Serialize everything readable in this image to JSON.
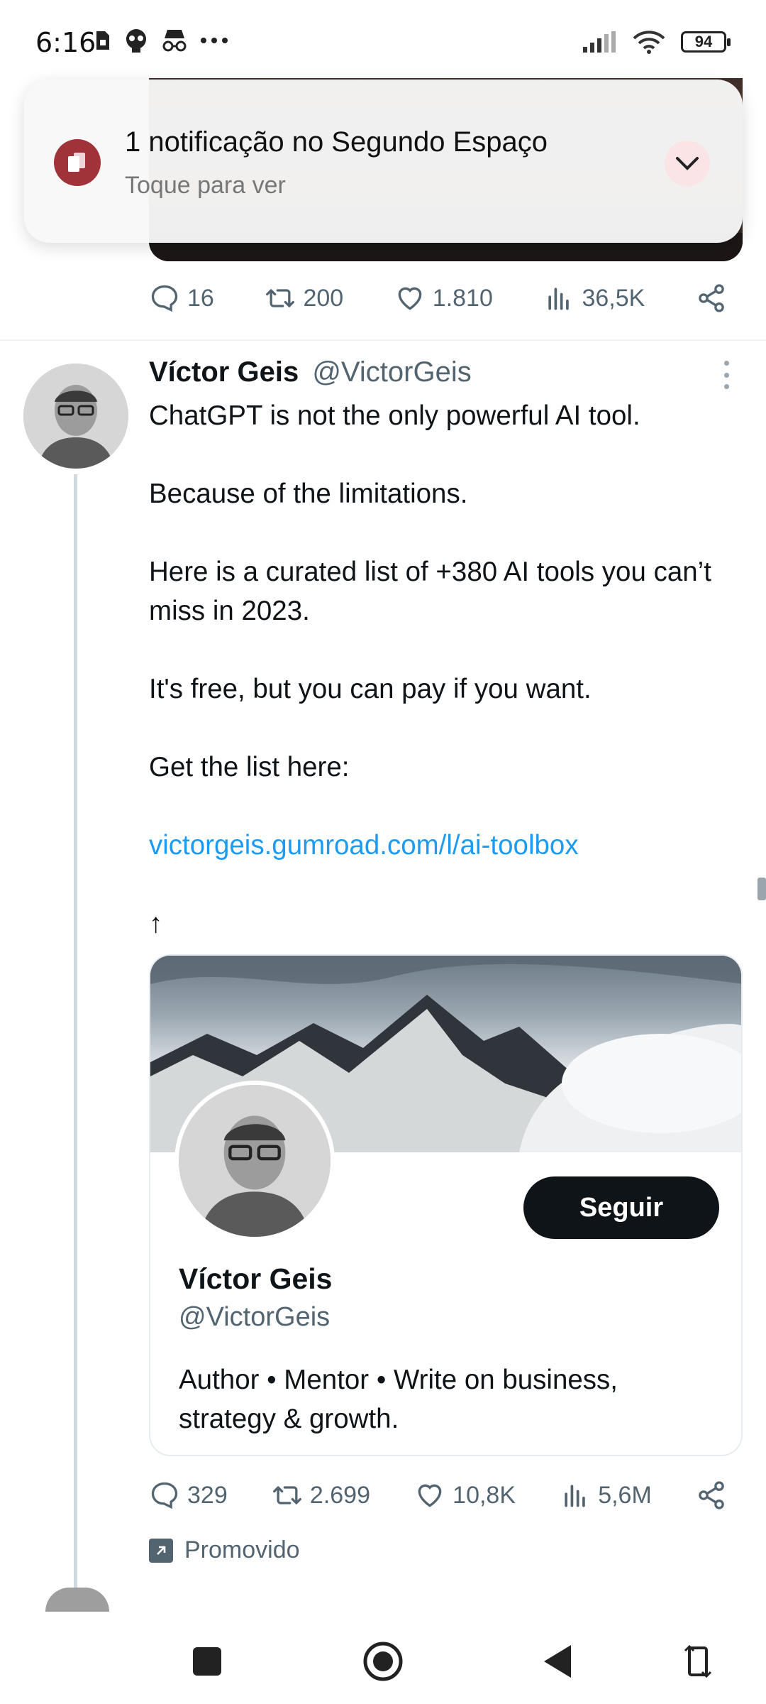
{
  "status_bar": {
    "time": "6:16",
    "battery": "94",
    "left_icons": [
      "sim-card-icon",
      "skull-icon",
      "incognito-icon",
      "more-dots-icon"
    ],
    "right_icons": [
      "signal-icon",
      "wifi-icon",
      "battery-icon"
    ]
  },
  "notification": {
    "title": "1 notificação no Segundo Espaço",
    "subtitle": "Toque para ver",
    "accent": "#a0333a"
  },
  "previous_tweet": {
    "replies": "16",
    "retweets": "200",
    "likes": "1.810",
    "views": "36,5K"
  },
  "tweet": {
    "author_name": "Víctor Geis",
    "author_handle": "@VictorGeis",
    "lines": [
      "ChatGPT is not the only powerful AI tool.",
      "",
      "Because of the limitations.",
      "",
      "Here is a curated list of +380 AI tools you can’t miss in 2023.",
      "",
      "It's free, but you can pay if you want.",
      "",
      "Get the list here:",
      ""
    ],
    "link": "victorgeis.gumroad.com/l/ai-toolbox",
    "arrow": "↑",
    "replies": "329",
    "retweets": "2.699",
    "likes": "10,8K",
    "views": "5,6M",
    "promoted_label": "Promovido"
  },
  "profile_card": {
    "name": "Víctor Geis",
    "handle": "@VictorGeis",
    "bio": "Author • Mentor • Write on business, strategy & growth.",
    "follow_label": "Seguir"
  },
  "colors": {
    "link": "#1d9bf0",
    "text": "#0f1419",
    "muted": "#536471"
  }
}
